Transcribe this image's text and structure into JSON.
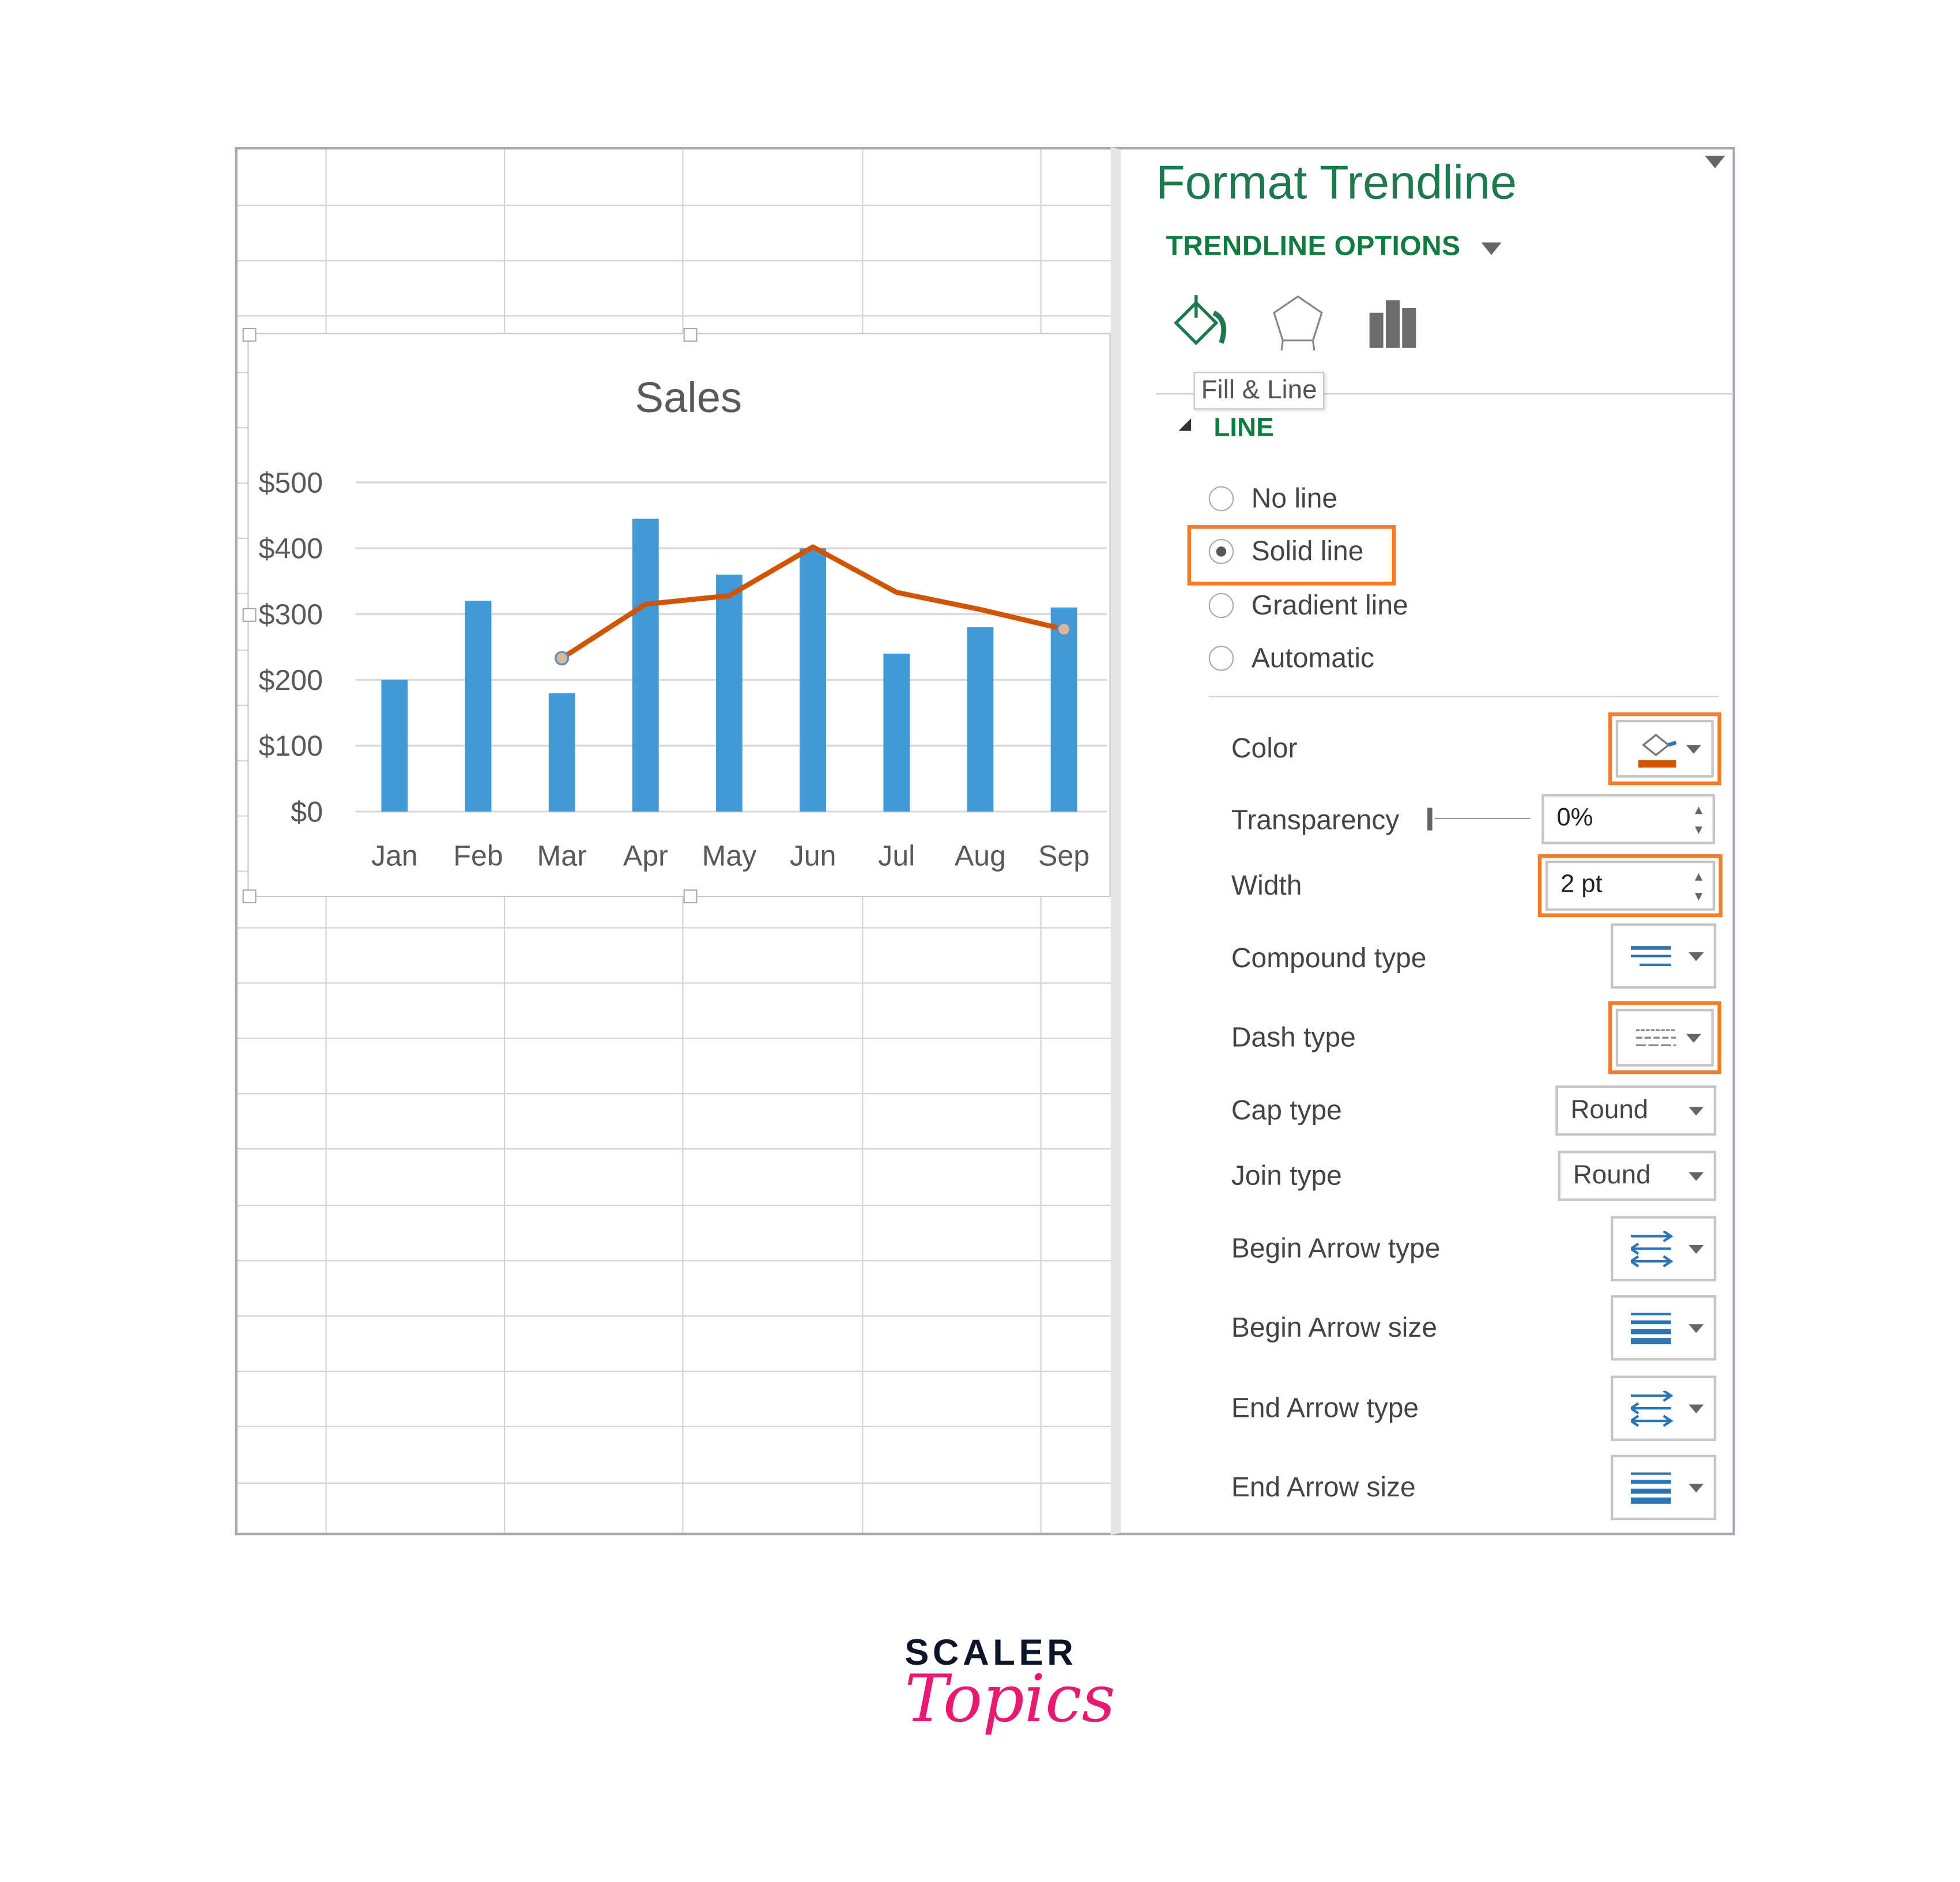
{
  "chart_data": {
    "type": "bar",
    "title": "Sales",
    "categories": [
      "Jan",
      "Feb",
      "Mar",
      "Apr",
      "May",
      "Jun",
      "Jul",
      "Aug",
      "Sep"
    ],
    "values": [
      200,
      320,
      180,
      445,
      360,
      400,
      240,
      280,
      310
    ],
    "y_ticks": [
      "$0",
      "$100",
      "$200",
      "$300",
      "$400",
      "$500"
    ],
    "ylim": [
      0,
      500
    ],
    "grid": true,
    "bar_color": "#4199d8",
    "trendline": {
      "type": "moving average (3 period)",
      "color": "#d35400",
      "categories": [
        "Mar",
        "Apr",
        "May",
        "Jun",
        "Jul",
        "Aug",
        "Sep"
      ],
      "values": [
        233,
        315,
        328,
        402,
        333,
        307,
        277
      ]
    }
  },
  "panel": {
    "title": "Format Trendline",
    "options_label": "TRENDLINE OPTIONS",
    "tabs": [
      {
        "icon": "fill-line-icon",
        "tooltip": "Fill & Line"
      },
      {
        "icon": "effects-pentagon-icon"
      },
      {
        "icon": "trendline-options-bar-icon"
      }
    ],
    "section": "LINE",
    "line_options": [
      {
        "label": "No line",
        "selected": false
      },
      {
        "label": "Solid line",
        "selected": true
      },
      {
        "label": "Gradient line",
        "selected": false
      },
      {
        "label": "Automatic",
        "selected": false
      }
    ],
    "color_label": "Color",
    "color_value": "#d35400",
    "transparency_label": "Transparency",
    "transparency_value": "0%",
    "width_label": "Width",
    "width_value": "2 pt",
    "compound_label": "Compound type",
    "dash_label": "Dash type",
    "cap_label": "Cap type",
    "cap_value": "Round",
    "join_label": "Join type",
    "join_value": "Round",
    "begin_arrow_type_label": "Begin Arrow type",
    "begin_arrow_size_label": "Begin Arrow size",
    "end_arrow_type_label": "End Arrow type",
    "end_arrow_size_label": "End Arrow size",
    "highlight_color": "#f57c2a"
  },
  "logo": {
    "line1": "SCALER",
    "line2": "Topics"
  }
}
